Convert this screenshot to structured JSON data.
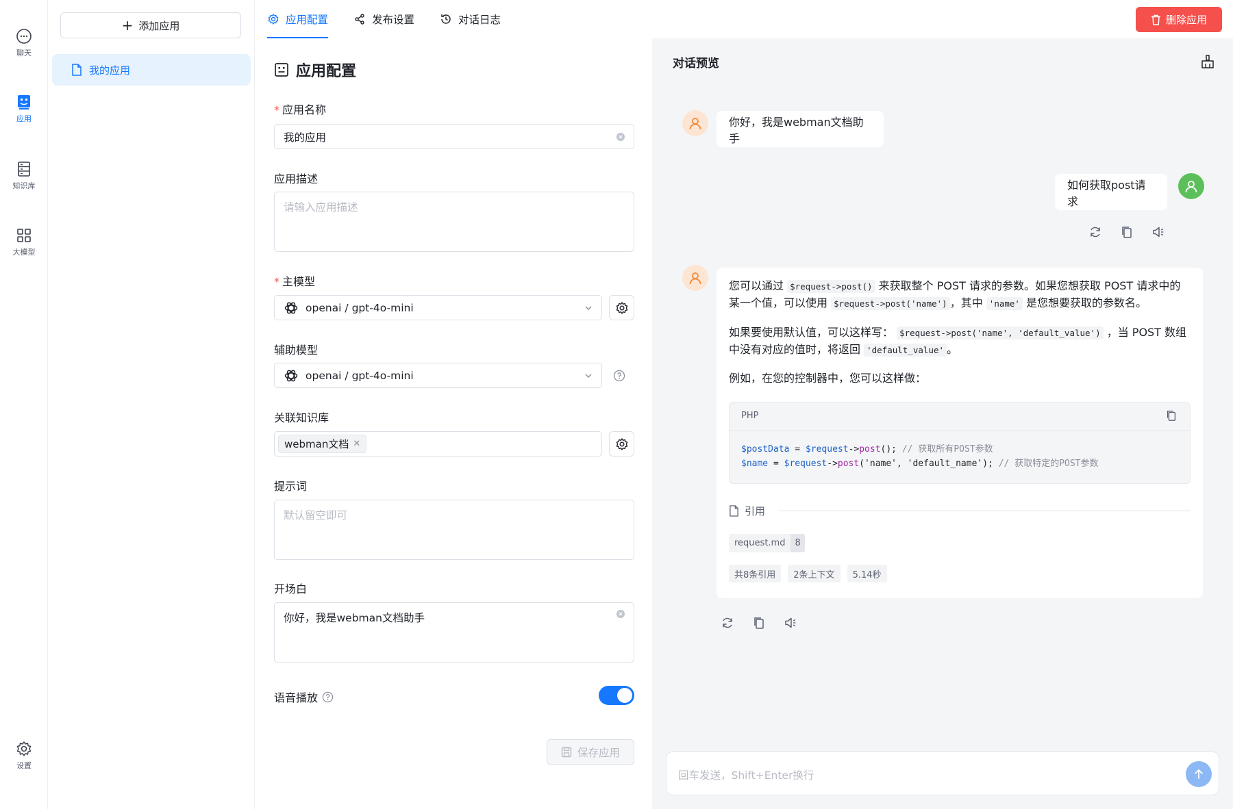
{
  "rail": {
    "items": [
      {
        "label": "聊天",
        "icon": "chat-icon"
      },
      {
        "label": "应用",
        "icon": "app-robot-icon",
        "active": true
      },
      {
        "label": "知识库",
        "icon": "knowledge-icon"
      },
      {
        "label": "大模型",
        "icon": "grid-icon"
      },
      {
        "label": "设置",
        "icon": "gear-icon"
      }
    ]
  },
  "applist": {
    "add_label": "添加应用",
    "items": [
      {
        "label": "我的应用",
        "active": true
      }
    ]
  },
  "tabs": [
    {
      "label": "应用配置",
      "icon": "gear-icon",
      "active": true
    },
    {
      "label": "发布设置",
      "icon": "share-icon"
    },
    {
      "label": "对话日志",
      "icon": "history-icon"
    }
  ],
  "delete_label": "删除应用",
  "form": {
    "title": "应用配置",
    "name": {
      "label": "应用名称",
      "value": "我的应用"
    },
    "description": {
      "label": "应用描述",
      "placeholder": "请输入应用描述"
    },
    "main_model": {
      "label": "主模型",
      "value": "openai / gpt-4o-mini"
    },
    "aux_model": {
      "label": "辅助模型",
      "value": "openai / gpt-4o-mini"
    },
    "knowledge": {
      "label": "关联知识库",
      "tags": [
        "webman文档"
      ]
    },
    "prompt": {
      "label": "提示词",
      "placeholder": "默认留空即可"
    },
    "greeting": {
      "label": "开场白",
      "value": "你好，我是webman文档助手"
    },
    "voice": {
      "label": "语音播放",
      "enabled": true
    },
    "save_label": "保存应用"
  },
  "preview": {
    "title": "对话预览",
    "greeting": "你好，我是webman文档助手",
    "user_message": "如何获取post请求",
    "answer": {
      "p1_a": "您可以通过",
      "p1_code1": "$request->post()",
      "p1_b": "来获取整个 POST 请求的参数。如果您想获取 POST 请求中的",
      "p1_c": "某一个值，可以使用",
      "p1_code2": "$request->post('name')",
      "p1_d": "，其中",
      "p1_code3": "'name'",
      "p1_e": "是您想要获取的参数名。",
      "p2_a": "如果要使用默认值，可以这样写：",
      "p2_code1": "$request->post('name', 'default_value')",
      "p2_b": "，当 POST 数组",
      "p2_c": "中没有对应的值时，将返回",
      "p2_code2": "'default_value'",
      "p2_d": "。",
      "p3": "例如，在您的控制器中，您可以这样做：",
      "code_lang": "PHP",
      "code_line1": {
        "var": "$postData",
        "op": " = ",
        "obj": "$request",
        "arrow": "->",
        "fn": "post",
        "args": "(); ",
        "comment": "// 获取所有POST参数"
      },
      "code_line2": {
        "var": "$name",
        "op": " = ",
        "obj": "$request",
        "arrow": "->",
        "fn": "post",
        "args": "('name', 'default_name'); ",
        "comment": "// 获取特定的POST参数"
      },
      "ref_label": "引用",
      "ref_file": "request.md",
      "ref_count": "8",
      "meta": [
        "共8条引用",
        "2条上下文",
        "5.14秒"
      ]
    },
    "input_placeholder": "回车发送，Shift+Enter换行"
  },
  "colors": {
    "accent": "#1677ff",
    "danger": "#f5504c",
    "bg_preview": "#f4f5f7"
  }
}
